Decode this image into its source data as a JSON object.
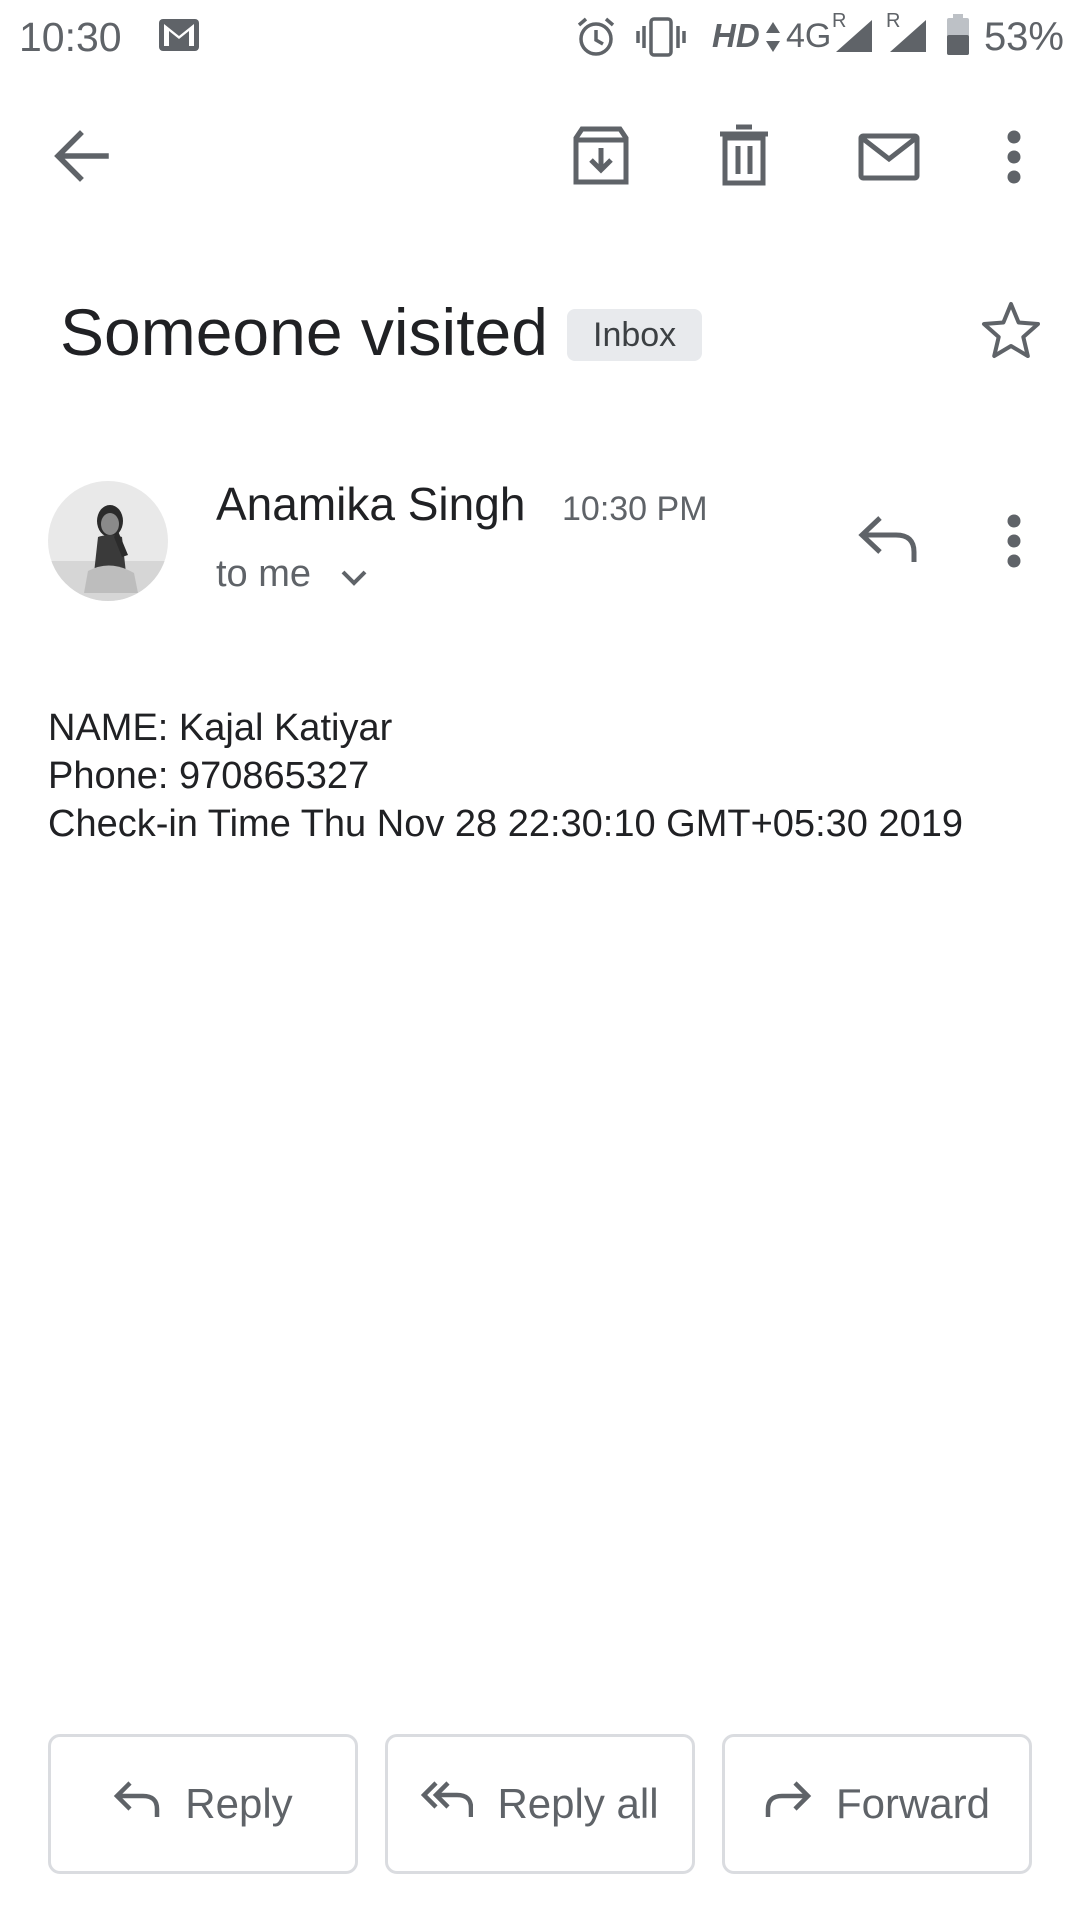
{
  "status_bar": {
    "time": "10:30",
    "network_hd": "HD",
    "network_type": "4G",
    "roaming_marker": "R",
    "battery_percent": "53%",
    "icons": [
      "gmail-notification-icon",
      "alarm-icon",
      "vibrate-icon",
      "signal-icon",
      "signal-icon",
      "battery-icon"
    ]
  },
  "app_bar": {
    "back_icon": "arrow-back-icon",
    "archive_icon": "archive-icon",
    "delete_icon": "delete-icon",
    "mark_unread_icon": "mail-icon",
    "more_icon": "more-vert-icon"
  },
  "subject": {
    "title": "Someone visited",
    "label": "Inbox",
    "star_icon": "star-outline-icon"
  },
  "message": {
    "sender_name": "Anamika Singh",
    "time": "10:30 PM",
    "recipient": "to me",
    "reply_icon": "reply-icon",
    "more_icon": "more-vert-icon",
    "body_lines": [
      "NAME: Kajal Katiyar",
      "Phone: 970865327",
      "Check-in Time Thu Nov 28 22:30:10 GMT+05:30 2019"
    ]
  },
  "actions": {
    "reply": "Reply",
    "reply_all": "Reply all",
    "forward": "Forward"
  },
  "colors": {
    "text_primary": "#202124",
    "text_secondary": "#5f6368",
    "chip_bg": "#e8eaed",
    "border": "#dadce0"
  }
}
